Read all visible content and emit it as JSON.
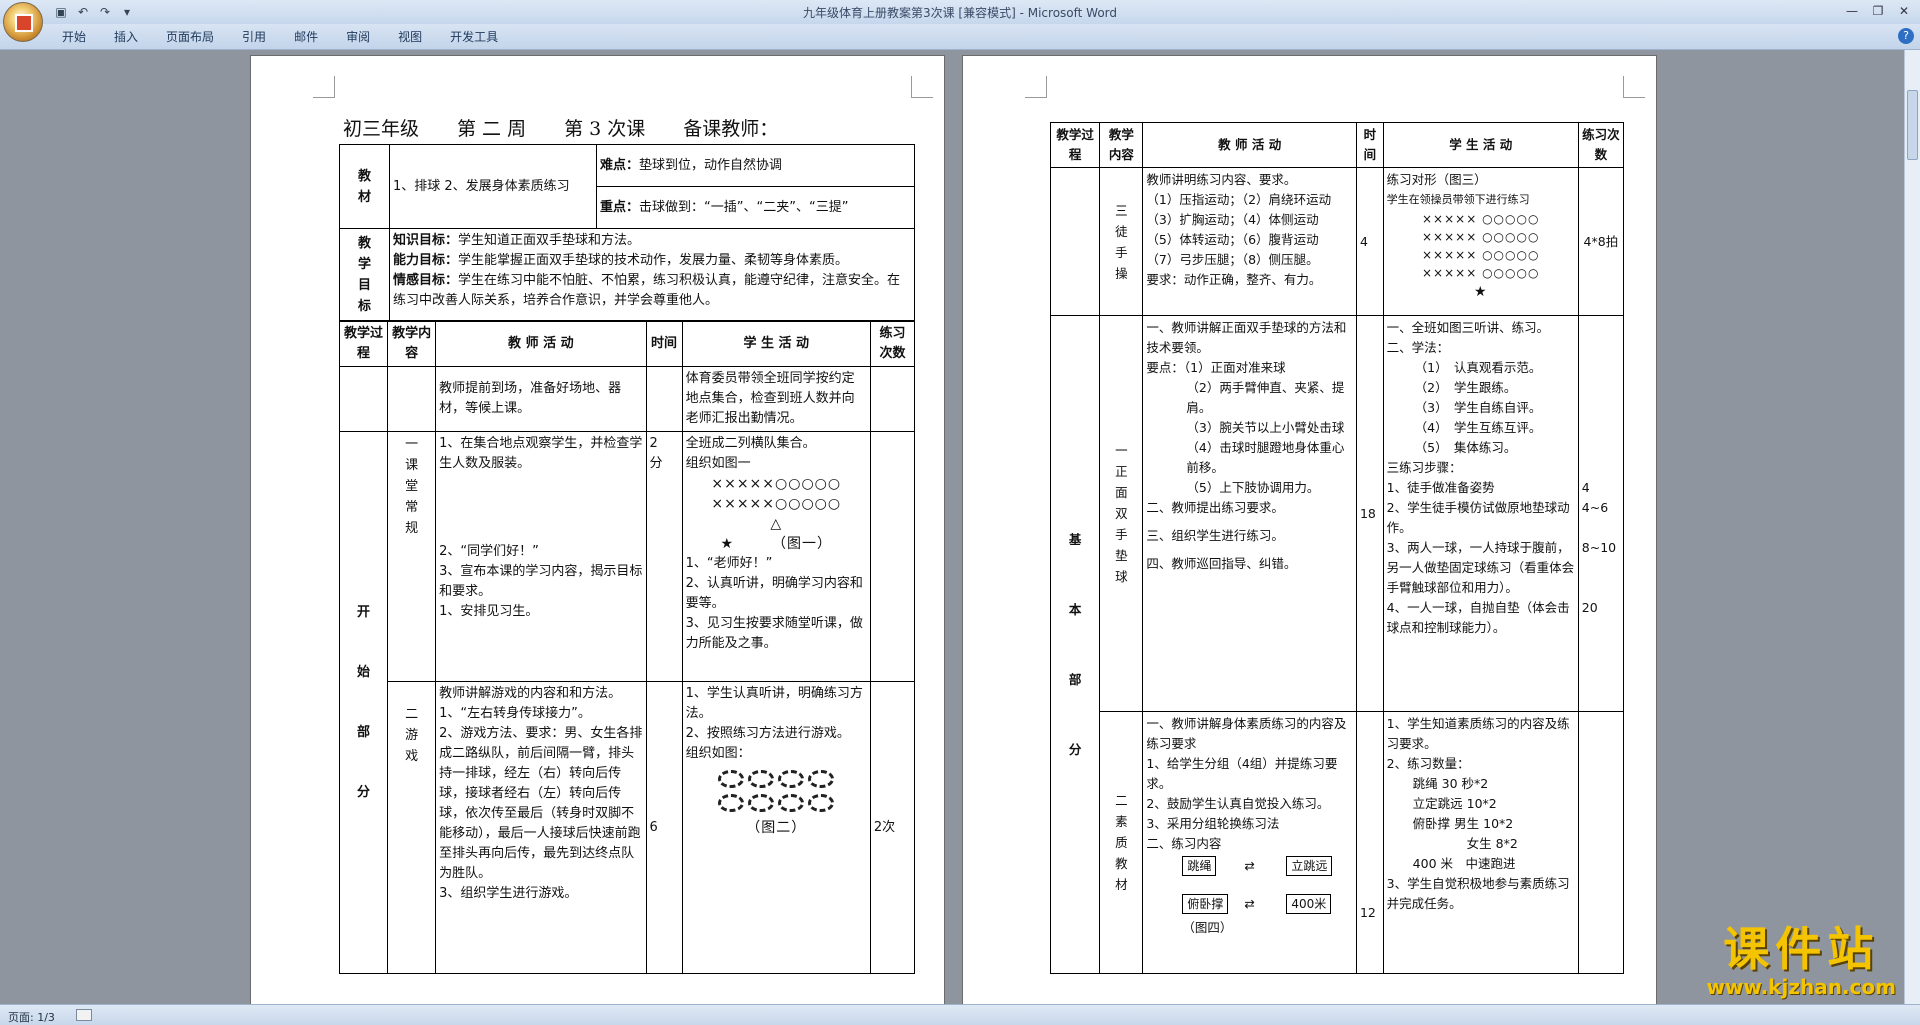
{
  "window": {
    "title": "九年级体育上册教案第3次课 [兼容模式] - Microsoft Word"
  },
  "ribbon": {
    "tabs": [
      "开始",
      "插入",
      "页面布局",
      "引用",
      "邮件",
      "审阅",
      "视图",
      "开发工具"
    ]
  },
  "status": {
    "page": "页面: 1/3"
  },
  "watermark": {
    "main": "课件站",
    "url": "www.kjzhan.com"
  },
  "page1": {
    "heading": "初三年级　　第 二 周　　第 3 次课　　备课教师：",
    "jiaocai_label": "教材",
    "jiaocai_text": "1、排球 2、发展身体素质练习",
    "nandian_label": "难点：",
    "nandian_text": "垫球到位，动作自然协调",
    "zhongdian_label": "重点：",
    "zhongdian_text": "击球做到：“一插”、“二夹”、“三提”",
    "mubiao_label": "教学目标",
    "zhishi_label": "知识目标：",
    "zhishi_text": "学生知道正面双手垫球和方法。",
    "nengli_label": "能力目标：",
    "nengli_text": "学生能掌握正面双手垫球的技术动作，发展力量、柔韧等身体素质。",
    "qinggan_label": "情感目标：",
    "qinggan_text": "学生在练习中能不怕脏、不怕累，练习积极认真，能遵守纪律，注意安全。在练习中改善人际关系，培养合作意识，并学会尊重他人。",
    "headers": [
      "教学过程",
      "教学内容",
      "教 师 活 动",
      "时间",
      "学 生 活 动",
      "练习次数"
    ],
    "row0_teacher": "教师提前到场，准备好场地、器材，等候上课。",
    "row0_student": "体育委员带领全班同学按约定地点集合，检查到班人数并向老师汇报出勤情况。",
    "section_kaishi": "开始部分",
    "row1_content": "一课堂常规",
    "row1_teacher": [
      "1、在集合地点观察学生，并检查学生人数及服装。",
      "2、“同学们好！”",
      "3、宣布本课的学习内容，揭示目标和要求。",
      "1、安排见习生。"
    ],
    "row1_time": "2分",
    "row1_student": [
      "全班成二列横队集合。",
      "组织如图一",
      "×××××○○○○○",
      "×××××○○○○○",
      "△",
      "★　　　（图一）",
      "1、“老师好！”",
      "2、认真听讲，明确学习内容和要等。",
      "3、见习生按要求随堂听课，做力所能及之事。"
    ],
    "row2_content": "二游戏",
    "row2_teacher": [
      "教师讲解游戏的内容和和方法。",
      "1、“左右转身传球接力”。",
      "2、游戏方法、要求：男、女生各排成二路纵队，前后间隔一臂，排头持一排球，经左（右）转向后传球，接球者经右（左）转向后传球，依次传至最后（转身时双脚不能移动），最后一人接球后快速前跑至排头再向后传，最先到达终点队为胜队。",
      "3、组织学生进行游戏。"
    ],
    "row2_time": "6",
    "row2_student": [
      "1、学生认真听讲，明确练习方法。",
      "2、按照练习方法进行游戏。",
      "组织如图：",
      "（图二）"
    ],
    "row2_count": "2次"
  },
  "page2": {
    "headers": [
      "教学过程",
      "教学内容",
      "教 师 活 动",
      "时间",
      "学 生 活 动",
      "练习次数"
    ],
    "r1_content": "三徒手操",
    "r1_teacher": [
      "教师讲明练习内容、要求。",
      "（1）压指运动；（2）肩绕环运动",
      "（3）扩胸运动；（4）体侧运动",
      "（5）体转运动；（6）腹背运动",
      "（7）弓步压腿；（8）侧压腿。",
      "要求：动作正确，整齐、有力。"
    ],
    "r1_time": "4",
    "r1_student": [
      "练习对形（图三）",
      "学生在领操员带领下进行练习",
      "××××× ○○○○○",
      "××××× ○○○○○",
      "××××× ○○○○○",
      "××××× ○○○○○",
      "★"
    ],
    "r1_count": "4*8拍",
    "section_jiben": "基本部分",
    "r2_content": "一正面双手垫球",
    "r2_teacher": [
      "一、教师讲解正面双手垫球的方法和技术要领。",
      "要点：（1）正面对准来球",
      "（2）两手臂伸直、夹紧、提肩。",
      "（3）腕关节以上小臂处击球",
      "（4）击球时腿蹬地身体重心前移。",
      "（5）上下肢协调用力。",
      "二、教师提出练习要求。",
      "三、组织学生进行练习。",
      "四、教师巡回指导、纠错。"
    ],
    "r2_time": "18",
    "r2_student": [
      "一、全班如图三听讲、练习。",
      "二、学法：",
      "（1）　认真观看示范。",
      "（2）　学生跟练。",
      "（3）　学生自练自评。",
      "（4）　学生互练互评。",
      "（5）　集体练习。",
      "三练习步骤：",
      "1、徒手做准备姿势",
      "2、学生徒手模仿试做原地垫球动作。",
      "3、两人一球，一人持球于腹前，另一人做垫固定球练习（看重体会手臂触球部位和用力）。",
      "4、一人一球，自抛自垫（体会击球点和控制球能力）。"
    ],
    "r2_count": [
      "4",
      "4~6",
      "8~10",
      "20"
    ],
    "r3_content": "二素质教材",
    "r3_teacher": [
      "一、教师讲解身体素质练习的内容及练习要求",
      "1、给学生分组（4组）并提练习要求。",
      "2、鼓励学生认真自觉投入练习。",
      "3、采用分组轮换练习法",
      "二、练习内容"
    ],
    "r3_boxes": [
      "跳绳",
      "立跳远",
      "俯卧撑",
      "400米",
      "（图四）"
    ],
    "r3_time": "12",
    "r3_student": [
      "1、学生知道素质练习的内容及练习要求。",
      "2、练习数量：",
      "跳绳 30 秒*2",
      "立定跳远 10*2",
      "俯卧撑 男生 10*2",
      "女生 8*2",
      "400 米　中速跑进",
      "3、学生自觉积极地参与素质练习并完成任务。"
    ]
  }
}
